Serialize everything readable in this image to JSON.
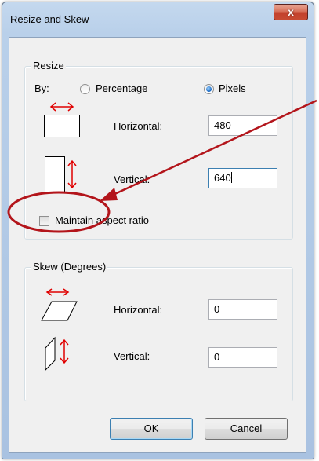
{
  "window": {
    "title": "Resize and Skew",
    "close_glyph": "x"
  },
  "resize": {
    "legend": "Resize",
    "by_label": "By:",
    "percentage_label": "Percentage",
    "pixels_label": "Pixels",
    "selected_unit": "Pixels",
    "horizontal_label": "Horizontal:",
    "horizontal_value": "480",
    "vertical_label": "Vertical:",
    "vertical_value": "640",
    "maintain_label": "Maintain aspect ratio",
    "maintain_checked": false
  },
  "skew": {
    "legend": "Skew (Degrees)",
    "horizontal_label": "Horizontal:",
    "horizontal_value": "0",
    "vertical_label": "Vertical:",
    "vertical_value": "0"
  },
  "buttons": {
    "ok_label": "OK",
    "cancel_label": "Cancel"
  },
  "colors": {
    "annotation_red": "#b3151b",
    "icon_red": "#e00000"
  },
  "icons": [
    "close-icon",
    "horizontal-resize-icon",
    "vertical-resize-icon",
    "horizontal-skew-icon",
    "vertical-skew-icon"
  ]
}
